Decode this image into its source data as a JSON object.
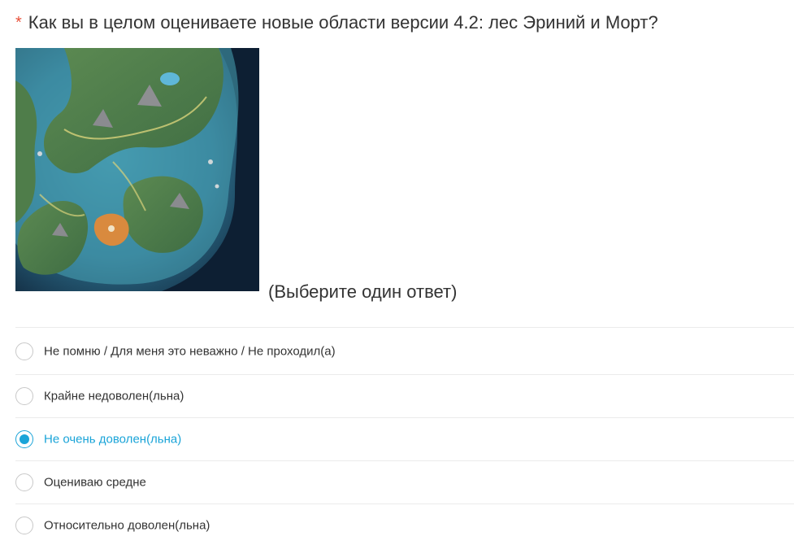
{
  "question": {
    "required_mark": "*",
    "title": "Как вы в целом оцениваете новые области версии 4.2: лес Эриний и Морт?",
    "hint": "(Выберите один ответ)",
    "image": {
      "semantic": "game-map-image"
    }
  },
  "options": [
    {
      "label": "Не помню / Для меня это неважно / Не проходил(а)",
      "selected": false
    },
    {
      "label": "Крайне недоволен(льна)",
      "selected": false
    },
    {
      "label": "Не очень доволен(льна)",
      "selected": true
    },
    {
      "label": "Оцениваю средне",
      "selected": false
    },
    {
      "label": "Относительно доволен(льна)",
      "selected": false
    }
  ],
  "colors": {
    "accent": "#1aa4d8",
    "required": "#e8513a",
    "text": "#333333",
    "divider": "#ebebeb"
  }
}
